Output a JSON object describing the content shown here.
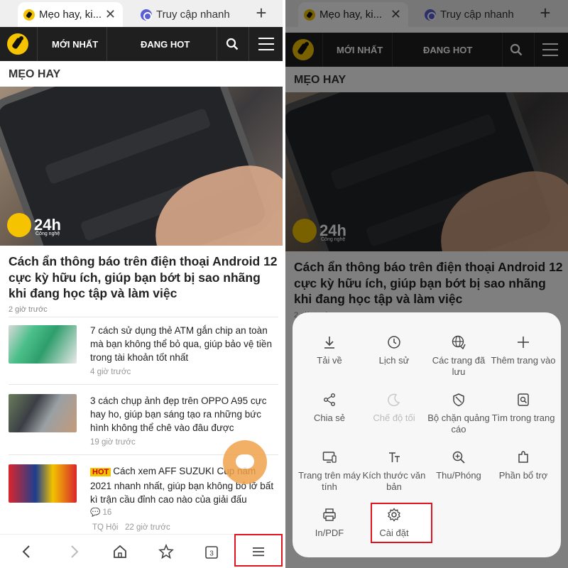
{
  "tabs": [
    {
      "title": "Mẹo hay, ki...",
      "close": "✕"
    },
    {
      "title": "Truy cập nhanh"
    }
  ],
  "new_tab": "+",
  "site_nav": {
    "latest": "MỚI NHẤT",
    "hot": "ĐANG HOT"
  },
  "section_title": "MẸO HAY",
  "hero": {
    "watermark": "24h",
    "watermark_sub": "Công nghệ"
  },
  "lead_article": {
    "title": "Cách ẩn thông báo trên điện thoại Android 12 cực kỳ hữu ích, giúp bạn bớt bị sao nhãng khi đang học tập và làm việc",
    "time": "2 giờ trước"
  },
  "articles": [
    {
      "title": "7 cách sử dụng thẻ ATM gắn chip an toàn mà bạn không thể bỏ qua, giúp bảo vệ tiền trong tài khoản tốt nhất",
      "time": "4 giờ trước"
    },
    {
      "title": "3 cách chụp ảnh đẹp trên OPPO A95 cực hay ho, giúp bạn sáng tạo ra những bức hình không thể chê vào đâu được",
      "time": "19 giờ trước"
    },
    {
      "badge": "HOT",
      "title": "Cách xem AFF SUZUKI Cup năm 2021 nhanh nhất, giúp bạn không bỏ lỡ bất kì trận cầu đỉnh cao nào của giải đấu",
      "comments": "16",
      "author": "TQ Hội",
      "time": "22 giờ trước"
    }
  ],
  "toolbar": {
    "tab_count": "3"
  },
  "menu": {
    "items": [
      {
        "label": "Tải về",
        "icon": "download-icon"
      },
      {
        "label": "Lịch sử",
        "icon": "history-icon"
      },
      {
        "label": "Các trang đã lưu",
        "icon": "saved-pages-icon"
      },
      {
        "label": "Thêm trang vào",
        "icon": "add-page-icon"
      },
      {
        "label": "Chia sẻ",
        "icon": "share-icon"
      },
      {
        "label": "Chế độ tối",
        "icon": "dark-mode-icon",
        "disabled": true
      },
      {
        "label": "Bộ chặn quảng cáo",
        "icon": "ad-blocker-icon"
      },
      {
        "label": "Tìm trong trang",
        "icon": "find-in-page-icon"
      },
      {
        "label": "Trang trên máy tính",
        "icon": "desktop-site-icon"
      },
      {
        "label": "Kích thước văn bản",
        "icon": "text-size-icon"
      },
      {
        "label": "Thu/Phóng",
        "icon": "zoom-icon"
      },
      {
        "label": "Phần bổ trợ",
        "icon": "addons-icon"
      },
      {
        "label": "In/PDF",
        "icon": "print-icon"
      },
      {
        "label": "Cài đặt",
        "icon": "settings-icon"
      }
    ]
  },
  "colors": {
    "accent": "#f5c300",
    "highlight": "#e1141f",
    "header_bg": "#1f1f1f"
  }
}
